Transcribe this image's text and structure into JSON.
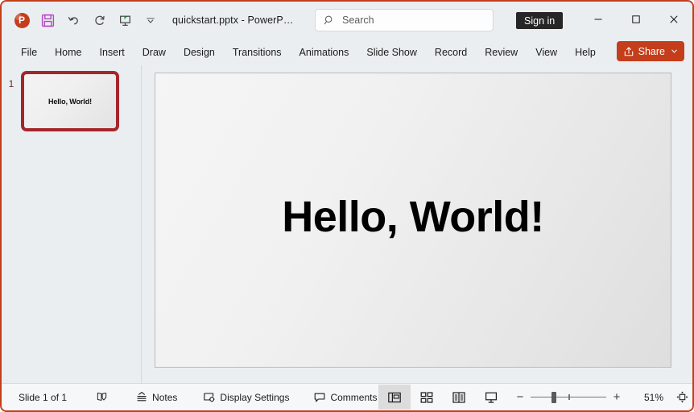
{
  "window": {
    "border_color": "#c43e1c",
    "chrome_bg": "#eaeef1"
  },
  "titlebar": {
    "app_icon": "powerpoint-logo-icon",
    "quick_access": [
      {
        "name": "save-button",
        "icon": "save-floppy-icon",
        "label": "Save"
      },
      {
        "name": "undo-button",
        "icon": "undo-arrow-icon",
        "label": "Undo"
      },
      {
        "name": "redo-button",
        "icon": "redo-arrow-icon",
        "label": "Redo"
      },
      {
        "name": "start-presentation-button",
        "icon": "start-presentation-icon",
        "label": "Start From Beginning"
      },
      {
        "name": "customize-quick-access-button",
        "icon": "chevron-down-icon",
        "label": "Customize Quick Access Toolbar"
      }
    ],
    "document_title": "quickstart.pptx  -  PowerP…",
    "signin_label": "Sign in",
    "window_controls": [
      {
        "name": "minimize-button",
        "glyph": "—"
      },
      {
        "name": "maximize-button",
        "glyph": "▢"
      },
      {
        "name": "close-button",
        "glyph": "✕"
      }
    ]
  },
  "search": {
    "placeholder": "Search",
    "icon": "search-icon"
  },
  "ribbon": {
    "tabs": [
      "File",
      "Home",
      "Insert",
      "Draw",
      "Design",
      "Transitions",
      "Animations",
      "Slide Show",
      "Record",
      "Review",
      "View",
      "Help"
    ],
    "active_tab": "Home",
    "share": {
      "label": "Share",
      "icon": "share-icon",
      "chevron": "chevron-down-icon",
      "color": "#c43e1c"
    }
  },
  "thumbnail_pane": {
    "slides": [
      {
        "number": "1",
        "text": "Hello, World!",
        "selected": true
      }
    ],
    "selection_color": "#a4262c"
  },
  "slide": {
    "title": "Hello, World!"
  },
  "statusbar": {
    "slide_count_label": "Slide 1 of 1",
    "accessibility": {
      "name": "accessibility-checker-button",
      "icon": "accessibility-book-icon"
    },
    "notes_label": "Notes",
    "display_settings_label": "Display Settings",
    "comments_label": "Comments",
    "views": [
      {
        "name": "view-normal",
        "icon": "normal-view-icon",
        "label": "Normal",
        "active": true
      },
      {
        "name": "view-slide-sorter",
        "icon": "slide-sorter-icon",
        "label": "Slide Sorter",
        "active": false
      },
      {
        "name": "view-reading",
        "icon": "reading-view-icon",
        "label": "Reading View",
        "active": false
      },
      {
        "name": "view-slide-show",
        "icon": "slide-show-icon",
        "label": "Slide Show",
        "active": false
      }
    ],
    "zoom": {
      "minus": "−",
      "plus": "+",
      "level": "51%",
      "slider_position_percent": 28,
      "fit_button": {
        "name": "fit-slide-to-window-button",
        "icon": "fit-to-window-icon"
      }
    }
  }
}
